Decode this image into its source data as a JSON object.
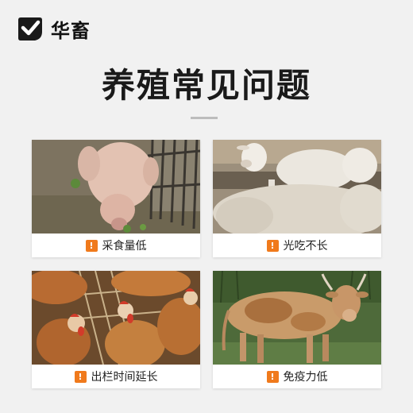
{
  "brand": {
    "name": "华畜",
    "icon": "check-shield-icon"
  },
  "page_title": "养殖常见问题",
  "cards": [
    {
      "photo": "pig-photo",
      "label": "采食量低",
      "icon": "warning-icon",
      "icon_glyph": "!"
    },
    {
      "photo": "sheep-photo",
      "label": "光吃不长",
      "icon": "warning-icon",
      "icon_glyph": "!"
    },
    {
      "photo": "chickens-photo",
      "label": "出栏时间延长",
      "icon": "warning-icon",
      "icon_glyph": "!"
    },
    {
      "photo": "cow-photo",
      "label": "免疫力低",
      "icon": "warning-icon",
      "icon_glyph": "!"
    }
  ],
  "colors": {
    "background": "#f1f1f1",
    "warning": "#f07a1c",
    "text": "#222222"
  }
}
